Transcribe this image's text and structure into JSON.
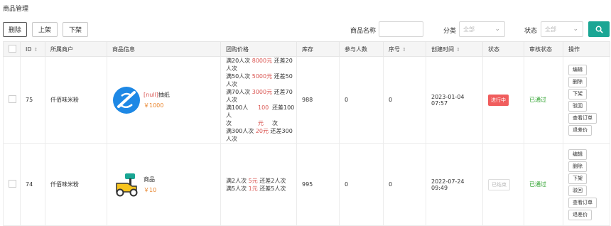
{
  "page_title": "商品管理",
  "toolbar": {
    "delete": "删除",
    "list": "上架",
    "unlist": "下架"
  },
  "filters": {
    "name_label": "商品名称",
    "category_label": "分类",
    "category_value": "全部",
    "status_label": "状态",
    "status_value": "全部"
  },
  "colors": {
    "accent": "#1aa694",
    "running": "#f05d5d",
    "approved": "#2aa02a",
    "price": "#e8832a"
  },
  "table": {
    "headers": [
      "ID",
      "所属商户",
      "商品信息",
      "团购价格",
      "库存",
      "参与人数",
      "序号",
      "创建时间",
      "状态",
      "审核状态",
      "操作"
    ],
    "rows": [
      {
        "id": "75",
        "merchant": "仟佰味米粉",
        "product_null": "[null]",
        "product_name": "抽纸",
        "price": "￥1000",
        "group": [
          [
            "满20人次 ",
            "8000元",
            " 还差20人次"
          ],
          [
            "满50人次 ",
            "5000元",
            " 还差50人次"
          ],
          [
            "满70人次 ",
            "3000元",
            " 还差70人次"
          ],
          [
            "满100人",
            "100",
            "还差100人"
          ],
          [
            "次",
            "元",
            "次"
          ],
          [
            "满300人次 ",
            "20元",
            " 还差300人次"
          ]
        ],
        "stock": "988",
        "participants": "0",
        "seq": "0",
        "created": "2023-01-04 07:57",
        "status": "进行中",
        "audit": "已通过",
        "ops": [
          "编辑",
          "删除",
          "下架",
          "驳回",
          "查看订单",
          "退差价"
        ]
      },
      {
        "id": "74",
        "merchant": "仟佰味米粉",
        "product_name": "商品",
        "price": "￥10",
        "group": [
          [
            "满2人次 ",
            "5元",
            " 还差2人次"
          ],
          [
            "满5人次 ",
            "1元",
            " 还差5人次"
          ]
        ],
        "stock": "995",
        "participants": "0",
        "seq": "0",
        "created": "2022-07-24 09:49",
        "status": "已结束",
        "audit": "已通过",
        "ops": [
          "编辑",
          "删除",
          "下架",
          "驳回",
          "查看订单",
          "退差价"
        ]
      }
    ]
  }
}
